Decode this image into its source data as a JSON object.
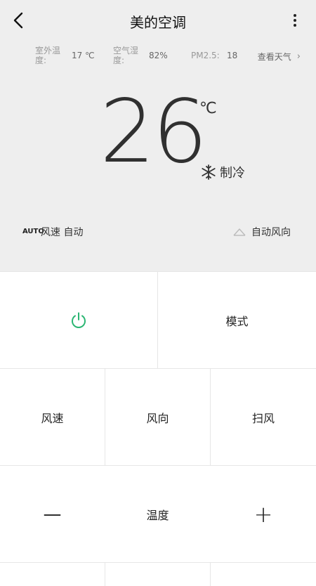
{
  "header": {
    "title": "美的空调",
    "back_icon": "chevron-left-icon",
    "more_icon": "more-vertical-icon"
  },
  "stats": {
    "outdoor_label": "室外温度:",
    "outdoor_value": "17 ℃",
    "humidity_label": "空气湿度:",
    "humidity_value": "82%",
    "pm_label": "PM2.5:",
    "pm_value": "18",
    "weather_link": "查看天气",
    "weather_chevron": "›"
  },
  "display": {
    "temperature": "26",
    "unit": "℃",
    "mode_icon": "snowflake-icon",
    "mode_label": "制冷"
  },
  "status": {
    "auto_badge": "AUTO",
    "fan_speed": "风速 自动",
    "wind_direction": "自动风向"
  },
  "controls": {
    "power_icon": "power-icon",
    "mode": "模式",
    "fan_speed": "风速",
    "wind_direction": "风向",
    "swing": "扫风",
    "minus": "—",
    "temperature": "温度",
    "plus": "+"
  },
  "colors": {
    "top_bg": "#eeeeee",
    "power_accent": "#2bb673",
    "divider": "#e6e6e6"
  }
}
